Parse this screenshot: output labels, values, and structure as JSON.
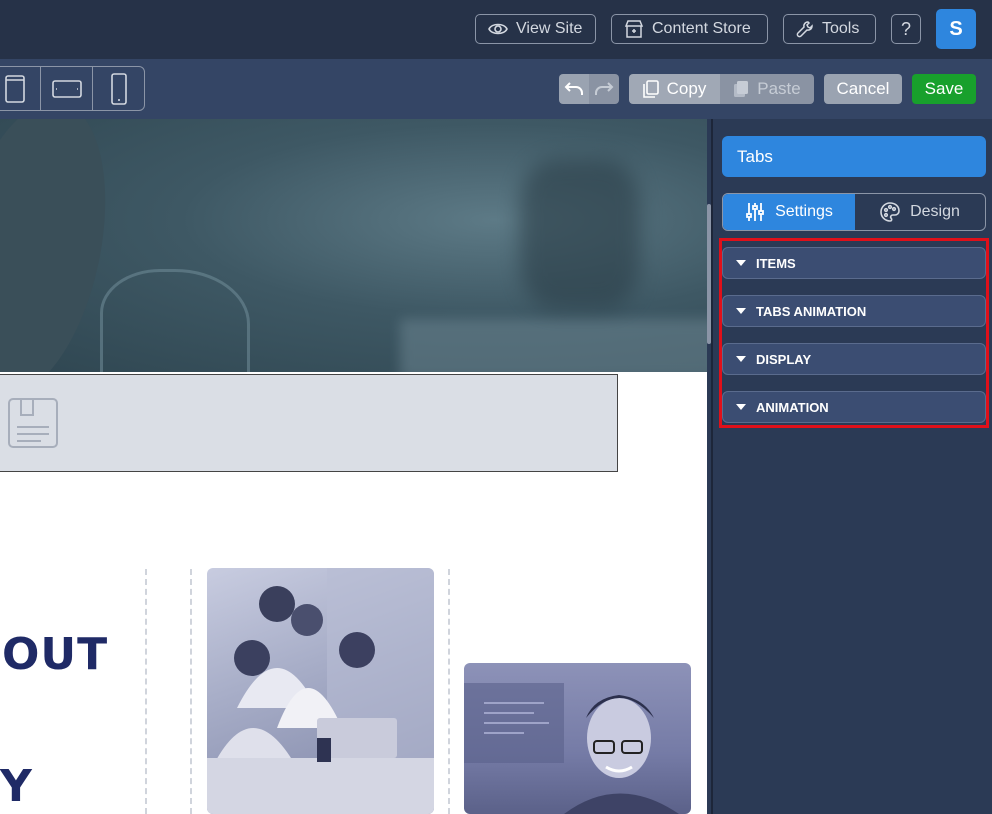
{
  "topbar": {
    "view_site": "View Site",
    "content_store": "Content Store",
    "tools": "Tools",
    "help": "?",
    "avatar_initial": "S"
  },
  "toolbar": {
    "copy": "Copy",
    "paste": "Paste",
    "cancel": "Cancel",
    "save": "Save"
  },
  "canvas": {
    "heading_line1": "OUT",
    "heading_line2": "Y"
  },
  "panel": {
    "title": "Tabs",
    "settings_tab": "Settings",
    "design_tab": "Design",
    "sections": [
      "ITEMS",
      "TABS ANIMATION",
      "DISPLAY",
      "ANIMATION"
    ]
  },
  "colors": {
    "accent": "#2e86de",
    "save": "#18a02c",
    "highlight": "#e0101a"
  },
  "icons": [
    "eye-icon",
    "store-icon",
    "wrench-icon",
    "tablet-icon",
    "tablet-landscape-icon",
    "phone-icon",
    "undo-icon",
    "redo-icon",
    "copy-icon",
    "paste-icon",
    "sliders-icon",
    "palette-icon",
    "form-placeholder-icon"
  ]
}
